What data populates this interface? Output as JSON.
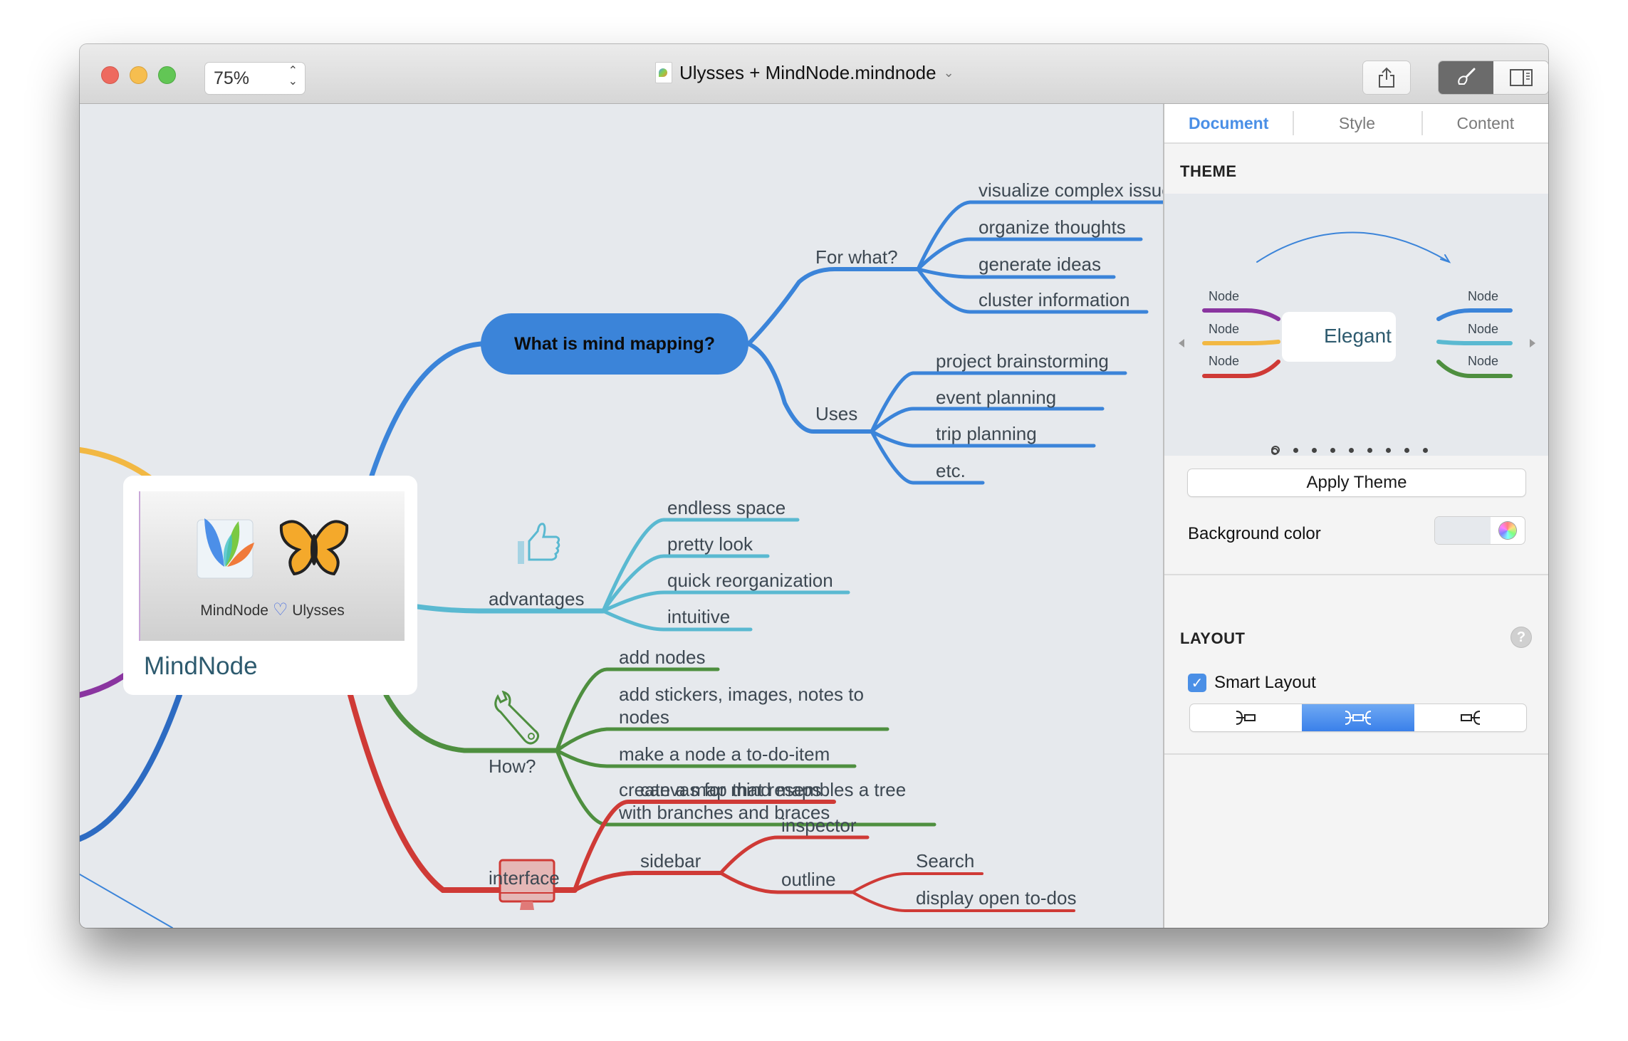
{
  "window": {
    "title": "Ulysses + MindNode.mindnode",
    "zoom": "75%",
    "toolbar": {
      "share_icon": "share-icon",
      "style_icon": "paintbrush-icon",
      "sidebar_icon": "sidebar-icon"
    }
  },
  "colors": {
    "blue": "#3b84d9",
    "cyan": "#5ab9d1",
    "green": "#4e8f3f",
    "red": "#cf3a36",
    "purple": "#8a35a0",
    "yellow": "#f2b843",
    "darkblue": "#2d6bc2",
    "accent": "#4a8fe6"
  },
  "mindmap": {
    "root": {
      "label": "MindNode",
      "image_caption_left": "MindNode",
      "image_caption_right": "Ulysses"
    },
    "main_topic": "What is mind mapping?",
    "for_what": {
      "label": "For what?",
      "children": [
        "visualize complex issues",
        "organize thoughts",
        "generate ideas",
        "cluster information"
      ]
    },
    "uses": {
      "label": "Uses",
      "children": [
        "project brainstorming",
        "event planning",
        "trip planning",
        "etc."
      ]
    },
    "advantages": {
      "label": "advantages",
      "icon": "thumbs-up-icon",
      "children": [
        "endless space",
        "pretty look",
        "quick reorganization",
        "intuitive"
      ]
    },
    "how": {
      "label": "How?",
      "icon": "wrench-icon",
      "children": [
        "add nodes",
        "add stickers, images, notes to",
        "nodes",
        "make a node a to-do-item",
        "create a map that resembles a tree",
        "with branches and braces"
      ]
    },
    "interface": {
      "label": "interface",
      "icon": "monitor-icon",
      "children": [
        "canvas for mind maps",
        "sidebar"
      ],
      "sidebar_children": [
        "inspector",
        "outline"
      ],
      "outline_children": [
        "Search",
        "display open to-dos"
      ]
    }
  },
  "sidebar": {
    "tabs": [
      {
        "label": "Document",
        "active": true
      },
      {
        "label": "Style",
        "active": false
      },
      {
        "label": "Content",
        "active": false
      }
    ],
    "theme": {
      "heading": "THEME",
      "preview_name": "Elegant",
      "node_label": "Node",
      "page_count": 9,
      "current_page": 1,
      "apply_label": "Apply Theme",
      "background_label": "Background color",
      "background_value": "#e6e9ed"
    },
    "layout": {
      "heading": "LAYOUT",
      "help": "?",
      "smart_layout_label": "Smart Layout",
      "smart_layout_checked": true,
      "options": [
        "right",
        "both",
        "left"
      ],
      "selected": "both"
    }
  }
}
